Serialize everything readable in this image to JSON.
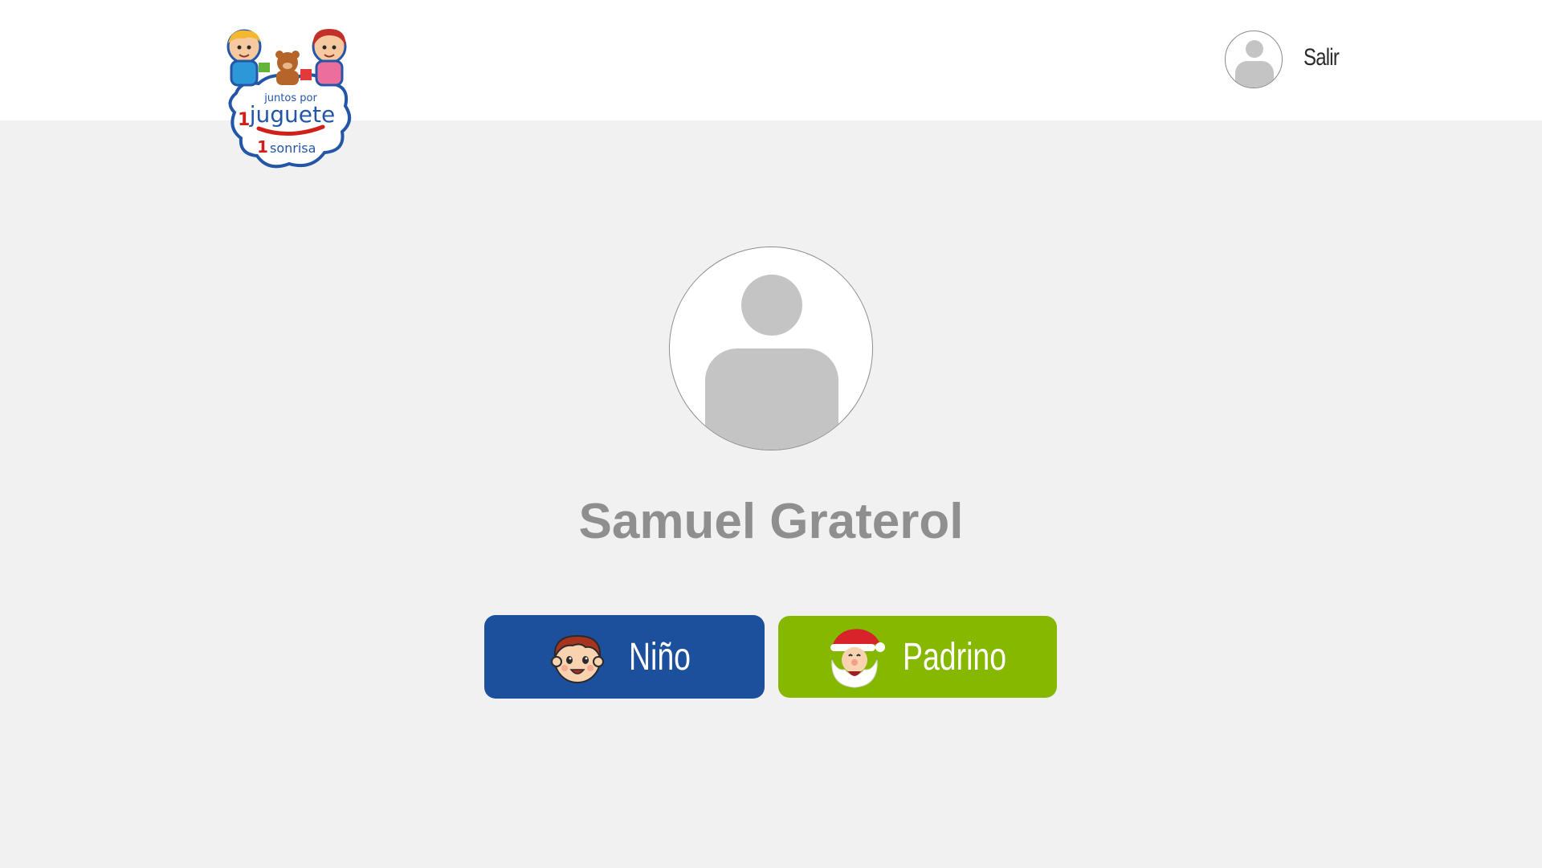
{
  "header": {
    "logo": {
      "line1": "juntos por",
      "line2": "juguete",
      "line3": "sonrisa",
      "number": "1"
    },
    "user_avatar_icon": "user-silhouette",
    "logout_label": "Salir"
  },
  "profile": {
    "avatar_icon": "user-silhouette",
    "name": "Samuel Graterol"
  },
  "roles": {
    "nino": {
      "label": "Niño",
      "icon": "child-face",
      "color": "#1c4f9c"
    },
    "padrino": {
      "label": "Padrino",
      "icon": "santa-face",
      "color": "#86b800"
    }
  },
  "colors": {
    "background": "#f1f1f1",
    "header": "#ffffff",
    "name_text": "#8f8f8f"
  }
}
